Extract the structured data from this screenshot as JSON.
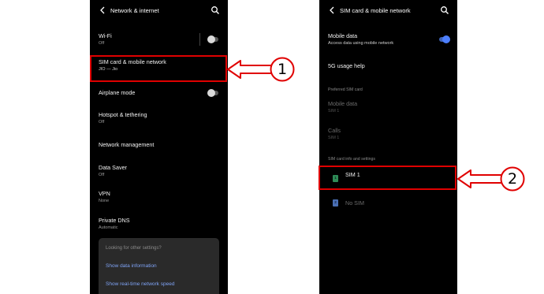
{
  "left_screen": {
    "title": "Network & internet",
    "items": [
      {
        "label": "Wi-Fi",
        "sub": "Off",
        "toggle": "off"
      },
      {
        "label": "SIM card & mobile network",
        "sub": "JIO — Jio"
      },
      {
        "label": "Airplane mode",
        "sub": "",
        "toggle": "off"
      },
      {
        "label": "Hotspot & tethering",
        "sub": "Off"
      },
      {
        "label": "Network management",
        "sub": ""
      },
      {
        "label": "Data Saver",
        "sub": "Off"
      },
      {
        "label": "VPN",
        "sub": "None"
      },
      {
        "label": "Private DNS",
        "sub": "Automatic"
      }
    ],
    "suggestion": {
      "heading": "Looking for other settings?",
      "links": [
        "Show data information",
        "Show real-time network speed"
      ]
    }
  },
  "right_screen": {
    "title": "SIM card & mobile network",
    "mobile_data": {
      "label": "Mobile data",
      "sub": "Access data using mobile network",
      "toggle": "on"
    },
    "usage_help": "5G usage help",
    "preferred_label": "Preferred SIM card",
    "preferred": [
      {
        "label": "Mobile data",
        "sub": "SIM 1"
      },
      {
        "label": "Calls",
        "sub": "SIM 1"
      }
    ],
    "sim_info_label": "SIM card info and settings",
    "sims": [
      {
        "label": "SIM 1",
        "icon_text": "1",
        "color": "#2e8b57"
      },
      {
        "label": "No SIM",
        "icon_text": "2",
        "color": "#4a6fb3"
      }
    ]
  },
  "callouts": [
    "1",
    "2"
  ],
  "colors": {
    "highlight": "#e00000",
    "accent": "#4d7fff",
    "link": "#7fa3f5"
  }
}
